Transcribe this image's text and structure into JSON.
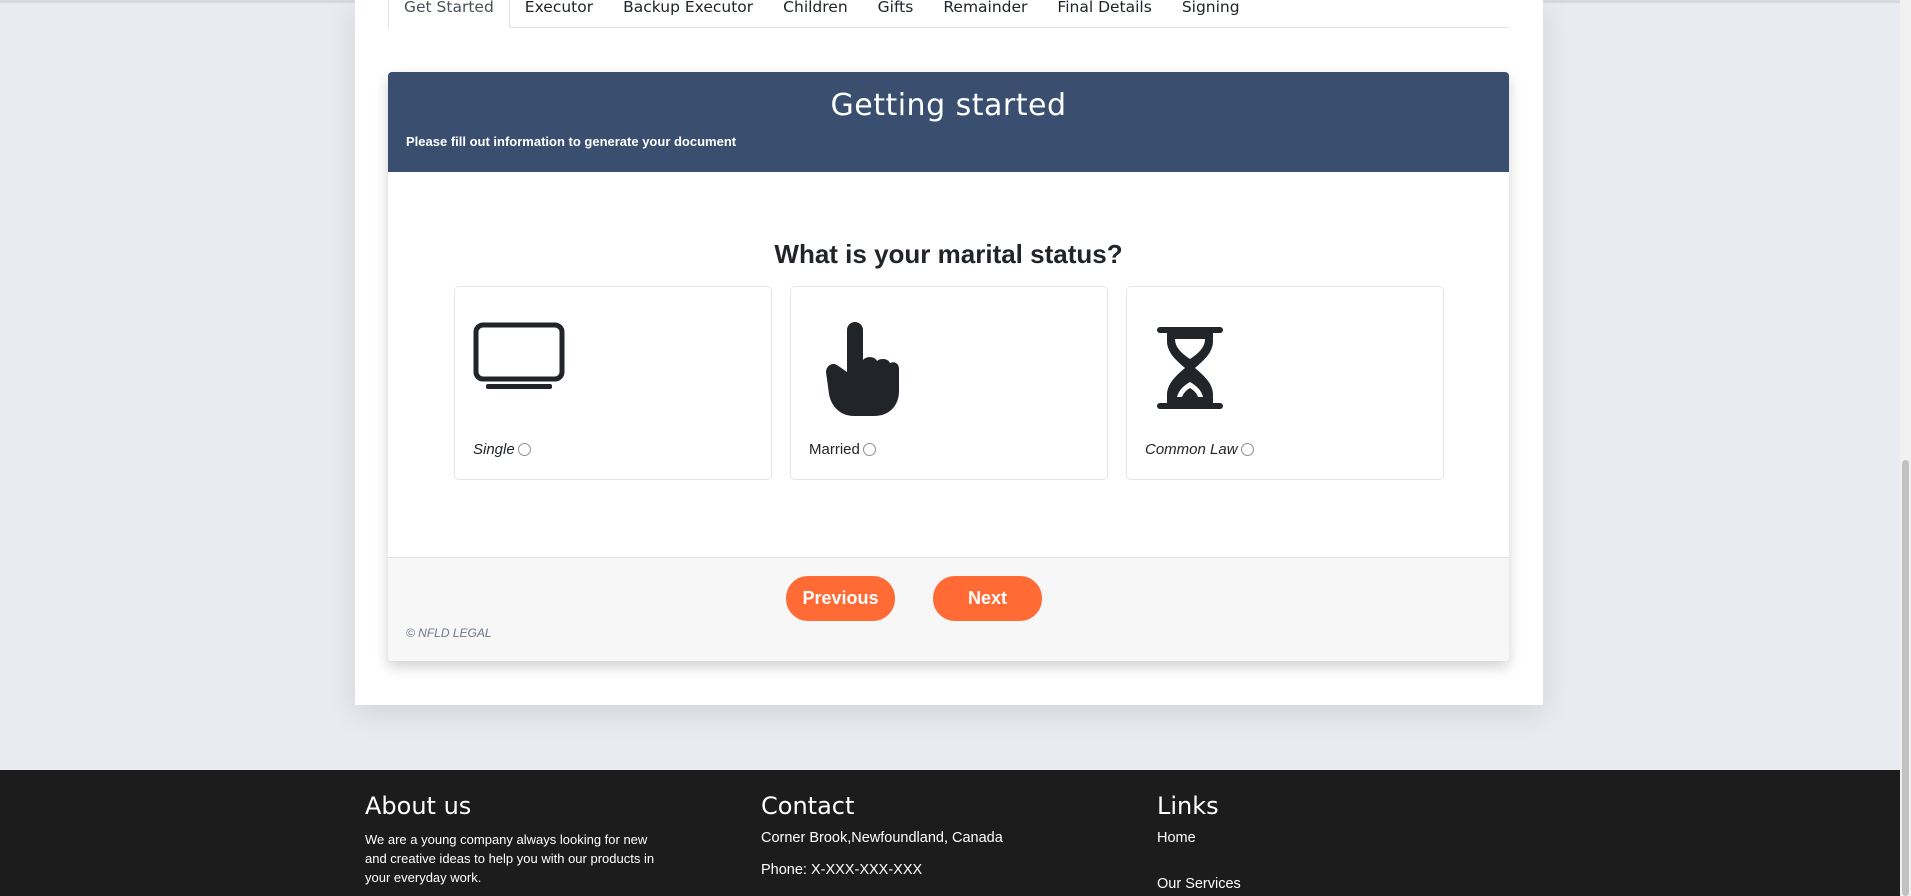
{
  "tabs": [
    {
      "label": "Get Started",
      "active": true
    },
    {
      "label": "Executor"
    },
    {
      "label": "Backup Executor"
    },
    {
      "label": "Children"
    },
    {
      "label": "Gifts"
    },
    {
      "label": "Remainder"
    },
    {
      "label": "Final Details"
    },
    {
      "label": "Signing"
    }
  ],
  "form": {
    "title": "Getting started",
    "subtitle": "Please fill out information to generate your document",
    "question": "What is your marital status?",
    "options": [
      {
        "label": "Single",
        "icon": "monitor-icon"
      },
      {
        "label": "Married",
        "icon": "pointing-hand-icon"
      },
      {
        "label": "Common Law",
        "icon": "hourglass-icon"
      }
    ],
    "previous_label": "Previous",
    "next_label": "Next",
    "copyright": "© NFLD LEGAL"
  },
  "footer": {
    "about": {
      "heading": "About us",
      "text": "We are a young company always looking for new and creative ideas to help you with our products in your everyday work."
    },
    "contact": {
      "heading": "Contact",
      "address": "Corner Brook,Newfoundland, Canada",
      "phone": "Phone: X-XXX-XXX-XXX"
    },
    "links": {
      "heading": "Links",
      "items": [
        "Home",
        "Our Services"
      ]
    }
  },
  "colors": {
    "header_bg": "#3a4f70",
    "button_bg": "#ff6a35",
    "footer_bg": "#1c1c1c"
  }
}
